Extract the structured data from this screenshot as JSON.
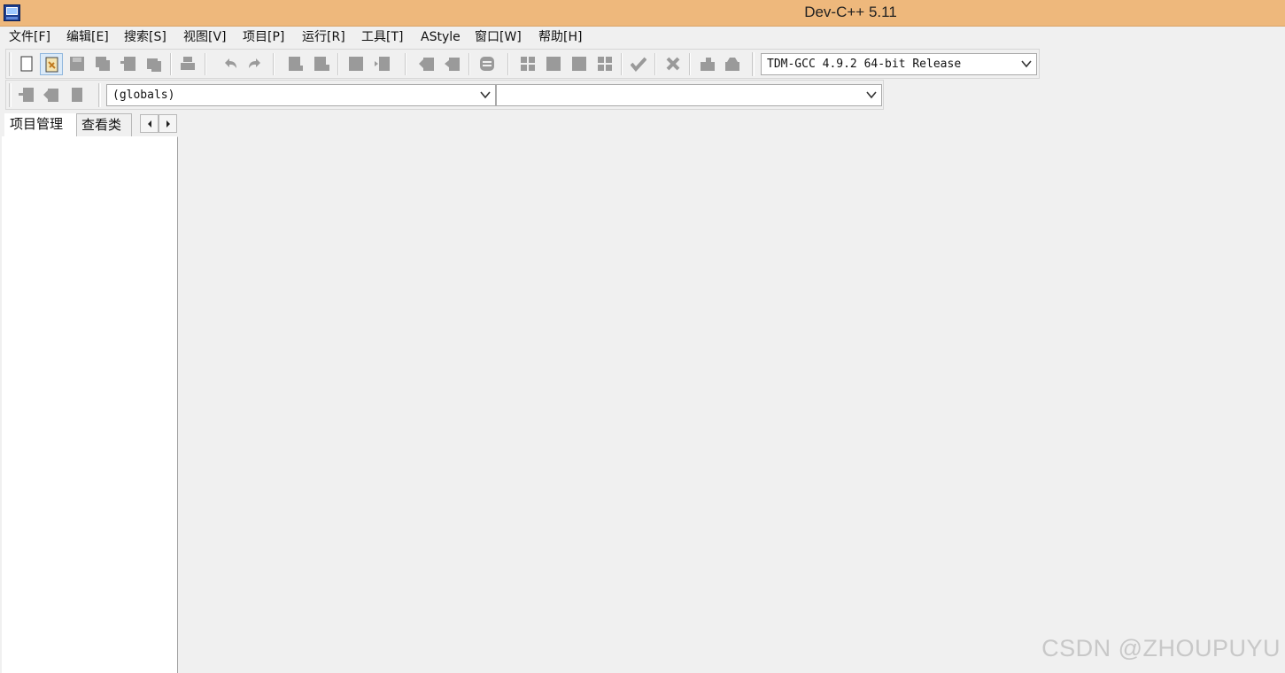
{
  "window": {
    "title": "Dev-C++ 5.11"
  },
  "menu": {
    "file": "文件[F]",
    "edit": "编辑[E]",
    "search": "搜索[S]",
    "view": "视图[V]",
    "project": "项目[P]",
    "run": "运行[R]",
    "tools": "工具[T]",
    "astyle": "AStyle",
    "window": "窗口[W]",
    "help": "帮助[H]"
  },
  "toolbar": {
    "compiler_selected": "TDM-GCC 4.9.2 64-bit Release",
    "scope_selected": "(globals)",
    "function_selected": ""
  },
  "left_panel": {
    "tabs": [
      {
        "label": "项目管理"
      },
      {
        "label": "查看类"
      }
    ]
  },
  "watermark": "CSDN @ZHOUPUYU",
  "colors": {
    "titlebar": "#eeb87c",
    "background": "#f0f0f0",
    "icon_gray": "#9a9a9a"
  }
}
